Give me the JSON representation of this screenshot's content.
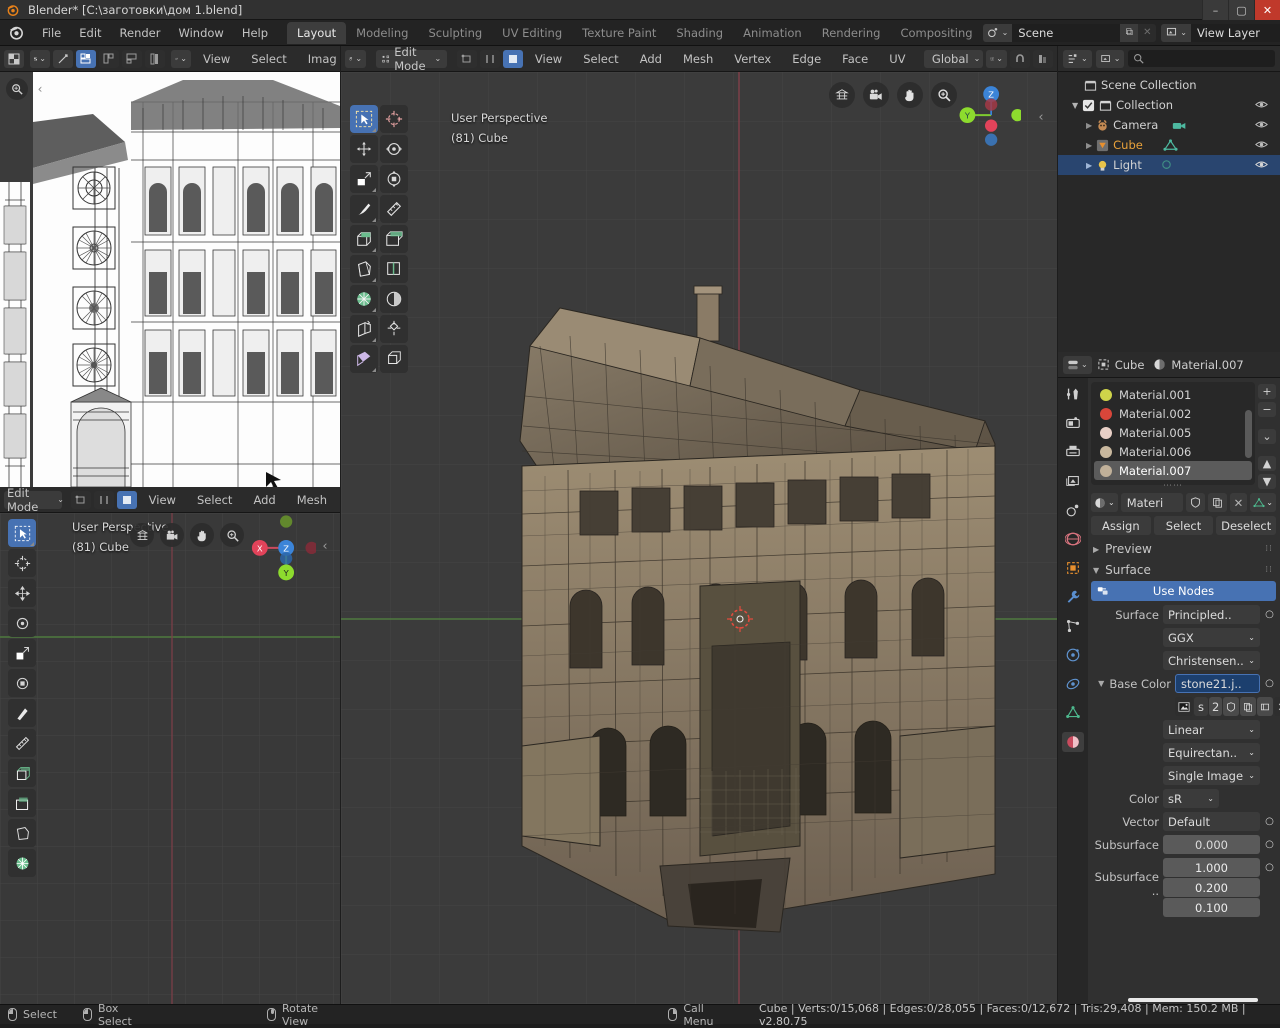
{
  "window": {
    "title": "Blender* [C:\\заготовки\\дом 1.blend]",
    "minimize": "–",
    "maximize": "▢",
    "close": "✕"
  },
  "topbar": {
    "menus": [
      "File",
      "Edit",
      "Render",
      "Window",
      "Help"
    ],
    "tabs": [
      {
        "label": "Layout",
        "active": true
      },
      {
        "label": "Modeling",
        "active": false
      },
      {
        "label": "Sculpting",
        "active": false
      },
      {
        "label": "UV Editing",
        "active": false
      },
      {
        "label": "Texture Paint",
        "active": false
      },
      {
        "label": "Shading",
        "active": false
      },
      {
        "label": "Animation",
        "active": false
      },
      {
        "label": "Rendering",
        "active": false
      },
      {
        "label": "Compositing",
        "active": false
      }
    ],
    "scene": {
      "name": "Scene",
      "new_label": "⧉",
      "close_label": "✕"
    },
    "view_layer": {
      "name": "View Layer",
      "new_label": "⧉",
      "close_label": "✕"
    }
  },
  "uv_editor": {
    "menus": [
      "View",
      "Select",
      "Imag"
    ],
    "mode_label": "UV Editor"
  },
  "viewport_main": {
    "mode": "Edit Mode",
    "menus": [
      "View",
      "Select",
      "Add",
      "Mesh",
      "Vertex",
      "Edge",
      "Face",
      "UV"
    ],
    "orientation": "Global",
    "overlay_line1": "User Perspective",
    "overlay_line2": "(81) Cube",
    "gizmo_axes": [
      "Z",
      "Y",
      "X"
    ]
  },
  "viewport_small": {
    "mode": "Edit Mode",
    "menus": [
      "View",
      "Select",
      "Add",
      "Mesh"
    ],
    "overlay_line1": "User Perspective",
    "overlay_line2": "(81) Cube",
    "gizmo_axes": [
      "Z",
      "Y",
      "X"
    ]
  },
  "outliner": {
    "search_placeholder": "",
    "rows": [
      {
        "label": "Scene Collection",
        "indent": 0,
        "type": "collection",
        "selected": false,
        "orange": false,
        "eye": false,
        "expander": ""
      },
      {
        "label": "Collection",
        "indent": 1,
        "type": "collection",
        "selected": false,
        "orange": false,
        "eye": true,
        "expander": "▼"
      },
      {
        "label": "Camera",
        "indent": 2,
        "type": "camera",
        "selected": false,
        "orange": false,
        "eye": true,
        "expander": "▶"
      },
      {
        "label": "Cube",
        "indent": 2,
        "type": "mesh",
        "selected": false,
        "orange": true,
        "eye": true,
        "expander": "▶"
      },
      {
        "label": "Light",
        "indent": 2,
        "type": "light",
        "selected": true,
        "orange": false,
        "eye": true,
        "expander": "▶"
      }
    ]
  },
  "properties": {
    "breadcrumb_object": "Cube",
    "breadcrumb_material": "Material.007",
    "material_slots": [
      {
        "name": "Material.001",
        "color": "#cfd44a",
        "selected": false
      },
      {
        "name": "Material.002",
        "color": "#d9463a",
        "selected": false
      },
      {
        "name": "Material.005",
        "color": "#e8cfc6",
        "selected": false
      },
      {
        "name": "Material.006",
        "color": "#c9b89e",
        "selected": false
      },
      {
        "name": "Material.007",
        "color": "#c0b099",
        "selected": true
      }
    ],
    "slot_buttons": {
      "add": "+",
      "remove": "−",
      "menu": "⌄",
      "up": "▲",
      "down": "▼"
    },
    "material_name_field": "Materi",
    "assign_buttons": [
      "Assign",
      "Select",
      "Deselect"
    ],
    "sections": [
      {
        "label": "Preview",
        "expanded": false
      },
      {
        "label": "Surface",
        "expanded": true
      }
    ],
    "use_nodes_label": "Use Nodes",
    "fields": [
      {
        "label": "Surface",
        "value": "Principled..",
        "type": "dropdown_dot"
      },
      {
        "label": "",
        "value": "GGX",
        "type": "dropdown"
      },
      {
        "label": "",
        "value": "Christensen..",
        "type": "dropdown"
      },
      {
        "label": "Base Color",
        "value": "stone21.j..",
        "type": "highlight_dot"
      },
      {
        "label": "",
        "value": "Linear",
        "type": "dropdown"
      },
      {
        "label": "",
        "value": "Equirectan..",
        "type": "dropdown"
      },
      {
        "label": "",
        "value": "Single Image",
        "type": "dropdown"
      },
      {
        "label": "Color",
        "value": "sR",
        "type": "dropdown_small"
      },
      {
        "label": "Vector",
        "value": "Default",
        "type": "dropdown_dot"
      },
      {
        "label": "Subsurface",
        "value": "0.000",
        "type": "value"
      }
    ],
    "image_tools": {
      "s_label": "s",
      "count_label": "2"
    },
    "subsurface_radius_label": "Subsurface ..",
    "subsurface_radius": [
      "1.000",
      "0.200",
      "0.100"
    ],
    "tabs": [
      "tool",
      "render",
      "output",
      "view-layer",
      "scene",
      "world",
      "object",
      "modifier",
      "particles",
      "physics",
      "constraint",
      "data",
      "material"
    ]
  },
  "statusbar": {
    "hints": [
      {
        "mouse": "left",
        "label": "Select"
      },
      {
        "mouse": "left-drag",
        "label": "Box Select"
      },
      {
        "mouse": "middle",
        "label": "Rotate View"
      },
      {
        "mouse": "right",
        "label": "Call Menu"
      }
    ],
    "info": "Cube | Verts:0/15,068 | Edges:0/28,055 | Faces:0/12,672 | Tris:29,408 | Mem: 150.2 MB | v2.80.75"
  },
  "colors": {
    "accent_blue": "#4772b3",
    "selected_row": "#29456f",
    "orange": "#e9a23b",
    "bg_dark": "#232323",
    "bg_panel": "#303030",
    "viewport": "#3b3b3b"
  }
}
